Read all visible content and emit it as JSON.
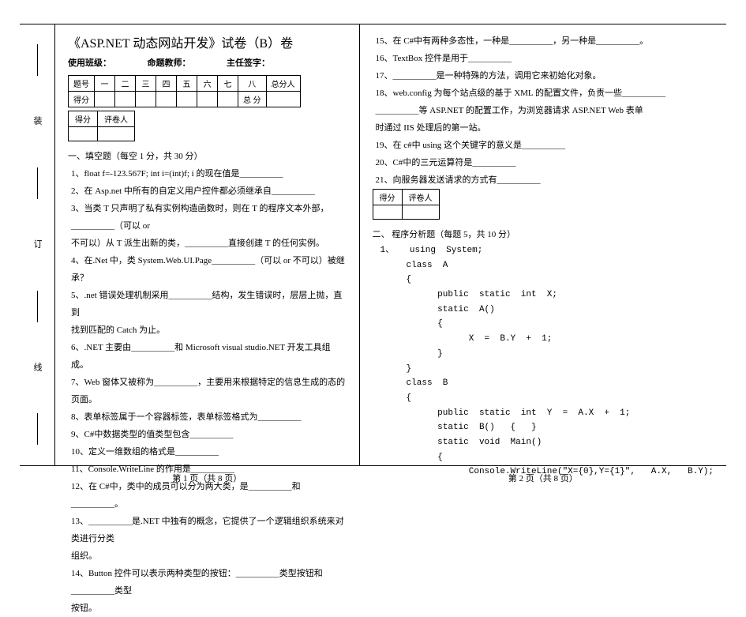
{
  "title": "《ASP.NET 动态网站开发》试卷（B）卷",
  "meta": {
    "class_label": "使用班级：",
    "teacher_label": "命题教师：",
    "head_label": "主任签字："
  },
  "score_table": {
    "headers": [
      "题号",
      "一",
      "二",
      "三",
      "四",
      "五",
      "六",
      "七",
      "八",
      "总分人"
    ],
    "row2_label": "得分",
    "row2_total": "总 分"
  },
  "small_score": {
    "c1": "得分",
    "c2": "评卷人"
  },
  "section1_title": "一、填空题（每空 1 分，共 30 分）",
  "q1": "1、float f=-123.567F; int i=(int)f; i 的现在值是__________",
  "q2": "2、在 Asp.net 中所有的自定义用户控件都必须继承自__________",
  "q3a": "3、当类 T 只声明了私有实例构造函数时，则在 T 的程序文本外部，__________（可以 or",
  "q3b": "不可以）从 T 派生出新的类，__________直接创建 T 的任何实例。",
  "q4": "4、在.Net 中，类 System.Web.UI.Page__________（可以 or 不可以）被继承？",
  "q5a": "5、.net 错误处理机制采用__________结构，发生错误时，层层上抛，直到",
  "q5b": "找到匹配的 Catch 为止。",
  "q6": "6、.NET 主要由__________和 Microsoft visual studio.NET 开发工具组成。",
  "q7": "7、Web 窗体又被称为__________，主要用来根据特定的信息生成的态的页面。",
  "q8": "8、表单标签属于一个容器标签，表单标签格式为__________",
  "q9": "9、C#中数据类型的值类型包含__________",
  "q10": "10、定义一维数组的格式是__________",
  "q11": "11、Console.WriteLine 的作用是__________",
  "q12": "12、在 C#中，类中的成员可以分为两大类，是__________和__________。",
  "q13a": "13、__________是.NET 中独有的概念，它提供了一个逻辑组织系统来对类进行分类",
  "q13b": "组织。",
  "q14a": "14、Button 控件可以表示两种类型的按钮：__________类型按钮和__________类型",
  "q14b": "按钮。",
  "q15": "15、在 C#中有两种多态性，一种是__________，另一种是__________。",
  "q16": "16、TextBox 控件是用于__________",
  "q17": "17、__________是一种特殊的方法，调用它来初始化对象。",
  "q18a": "18、web.config 为每个站点级的基于 XML 的配置文件，负责一些__________",
  "q18b": "__________等 ASP.NET 的配置工作，为浏览器请求 ASP.NET Web 表单",
  "q18c": "时通过 IIS 处理后的第一站。",
  "q19": "19、在 c#中 using 这个关键字的意义是__________",
  "q20": "20、C#中的三元运算符是__________",
  "q21": "21、向服务器发送请求的方式有__________",
  "section2_title": "二、   程序分析题（每题 5，共 10 分）",
  "code": {
    "l1": "1、   using  System;",
    "l2": "     class  A",
    "l3": "     {",
    "l4": "           public  static  int  X;",
    "l5": "           static  A()",
    "l6": "           {",
    "l7": "                 X  =  B.Y  +  1;",
    "l8": "           }",
    "l9": "     }",
    "l10": "     class  B",
    "l11": "     {",
    "l12": "           public  static  int  Y  =  A.X  +  1;",
    "l13": "           static  B()   {   }",
    "l14": "           static  void  Main()",
    "l15": "           {",
    "l16": "                 Console.WriteLine(\"X={0},Y={1}\",   A.X,   B.Y);"
  },
  "binding": {
    "m1": "装",
    "m2": "订",
    "m3": "线"
  },
  "page1": "第 1 页（共 8 页）",
  "page2": "第 2 页（共 8 页）"
}
